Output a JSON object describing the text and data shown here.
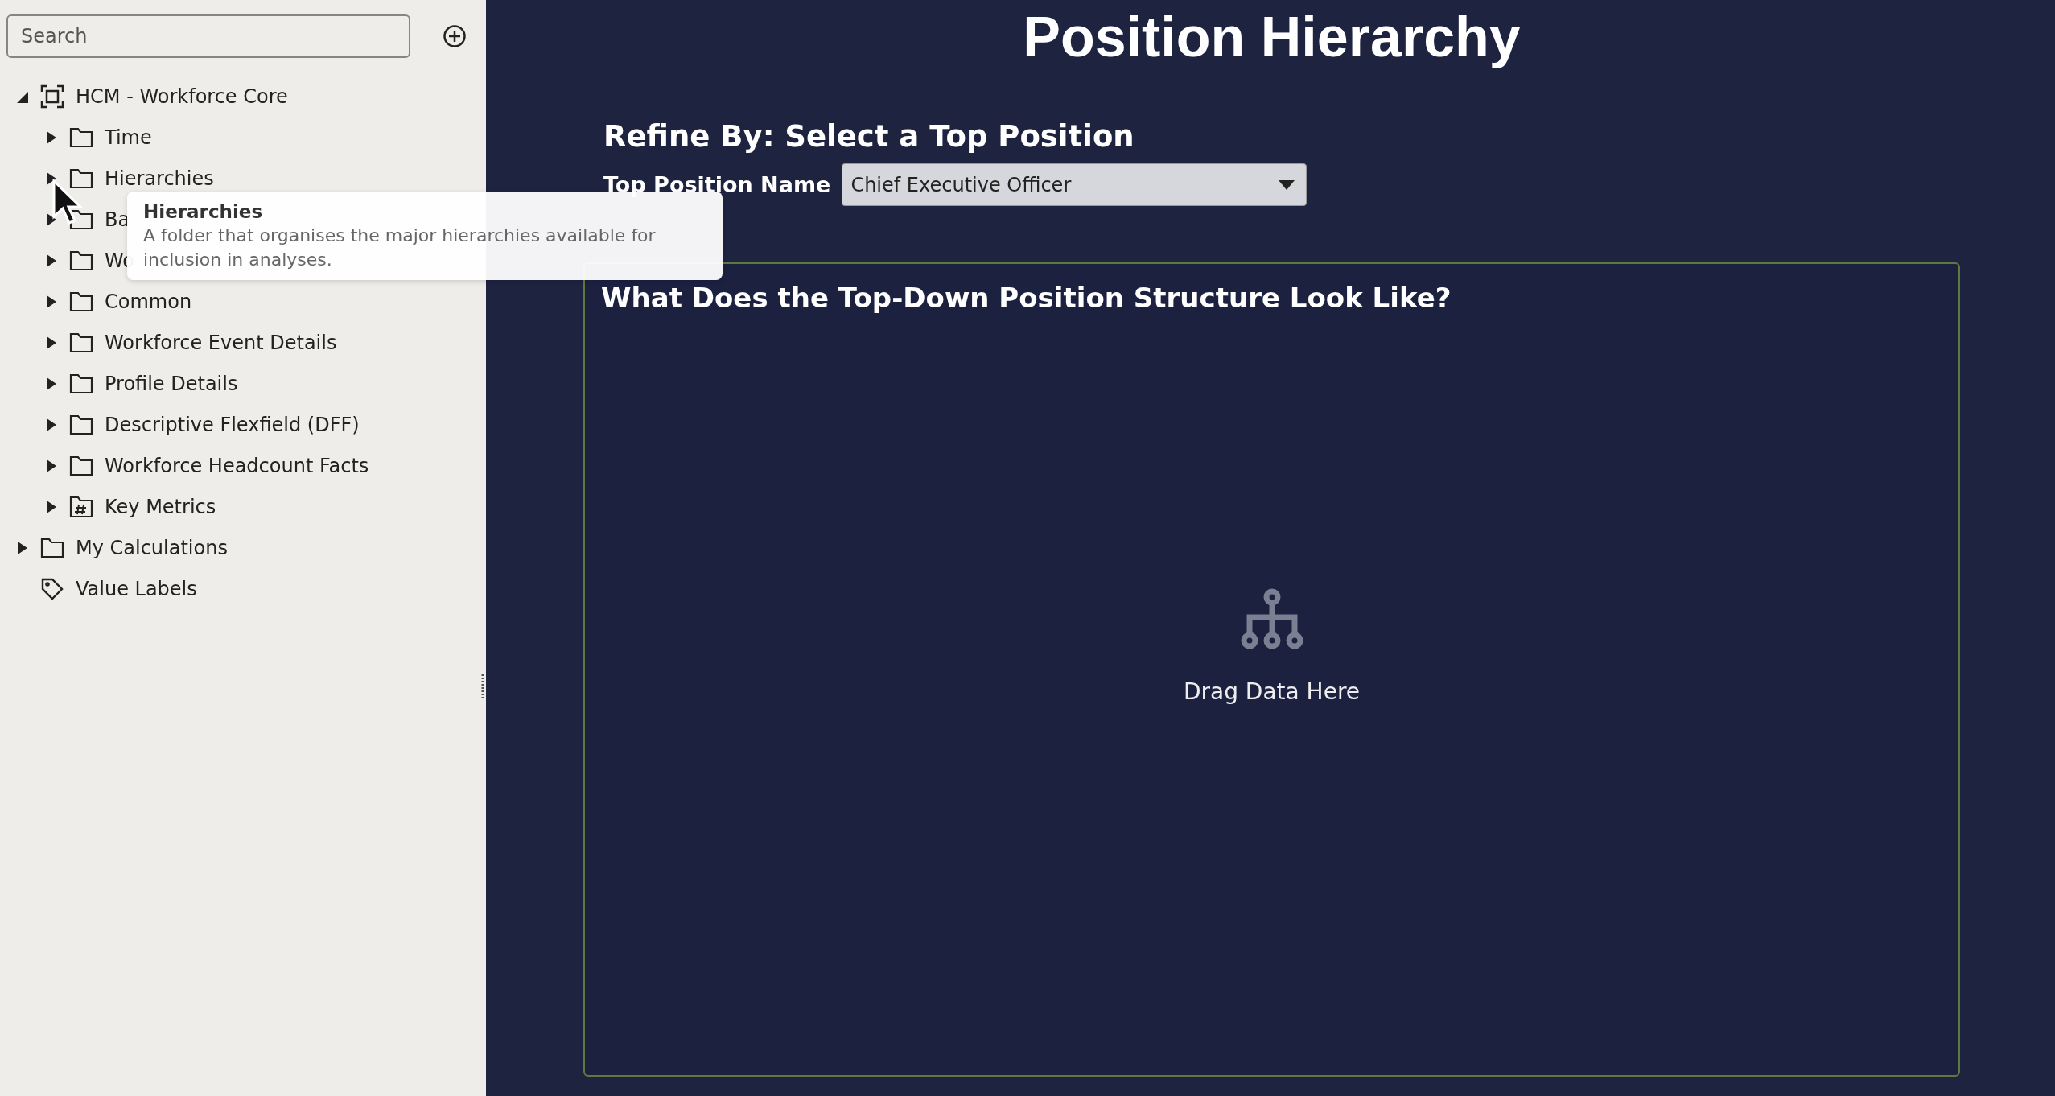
{
  "sidebar": {
    "search": {
      "placeholder": "Search"
    },
    "tree": [
      {
        "label": "HCM - Workforce Core",
        "kind": "subject-area",
        "expanded": true,
        "children": [
          {
            "label": "Time",
            "kind": "folder",
            "expanded": false
          },
          {
            "label": "Hierarchies",
            "kind": "folder",
            "expanded": false
          },
          {
            "label": "Ba",
            "kind": "folder",
            "expanded": false
          },
          {
            "label": "Wo",
            "kind": "folder",
            "expanded": false
          },
          {
            "label": "Common",
            "kind": "folder",
            "expanded": false
          },
          {
            "label": "Workforce Event Details",
            "kind": "folder",
            "expanded": false
          },
          {
            "label": "Profile Details",
            "kind": "folder",
            "expanded": false
          },
          {
            "label": "Descriptive Flexfield (DFF)",
            "kind": "folder",
            "expanded": false
          },
          {
            "label": "Workforce Headcount Facts",
            "kind": "folder",
            "expanded": false
          },
          {
            "label": "Key Metrics",
            "kind": "metrics",
            "expanded": false
          }
        ]
      },
      {
        "label": "My Calculations",
        "kind": "folder",
        "expanded": false
      },
      {
        "label": "Value Labels",
        "kind": "label"
      }
    ],
    "tooltip": {
      "title": "Hierarchies",
      "text": "A folder that organises the major hierarchies available for inclusion in analyses."
    }
  },
  "canvas": {
    "title": "Position Hierarchy",
    "refine_heading": "Refine By: Select a Top Position",
    "filter": {
      "label": "Top Position Name",
      "value": "Chief Executive Officer"
    },
    "panel": {
      "title": "What Does the Top-Down Position Structure Look Like?",
      "placeholder": "Drag Data Here"
    }
  }
}
